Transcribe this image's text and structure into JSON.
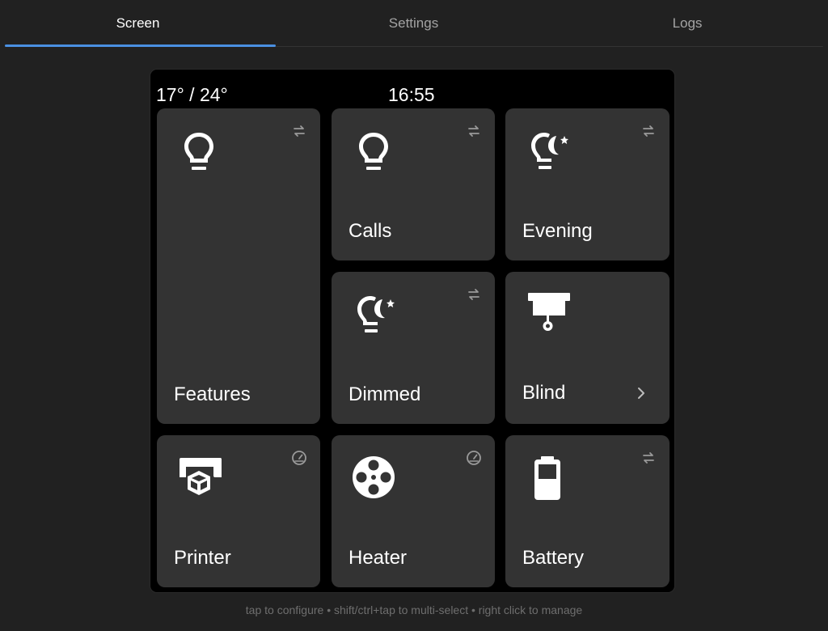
{
  "tabs": [
    {
      "label": "Screen",
      "active": true
    },
    {
      "label": "Settings",
      "active": false
    },
    {
      "label": "Logs",
      "active": false
    }
  ],
  "accent_color": "#4a90e2",
  "status_bar": {
    "temperature": "17° / 24°",
    "time": "16:55"
  },
  "tiles": [
    {
      "label": "Features",
      "icon": "lightbulb-icon",
      "corner_icon": "swap-arrows-icon"
    },
    {
      "label": "Calls",
      "icon": "lightbulb-icon",
      "corner_icon": "swap-arrows-icon"
    },
    {
      "label": "Evening",
      "icon": "lightbulb-night-icon",
      "corner_icon": "swap-arrows-icon"
    },
    {
      "label": "Dimmed",
      "icon": "lightbulb-night-icon",
      "corner_icon": "swap-arrows-icon"
    },
    {
      "label": "Blind",
      "icon": "roller-blind-icon",
      "corner_icon": "chevron-right-icon"
    },
    {
      "label": "Printer",
      "icon": "3d-printer-icon",
      "corner_icon": "gauge-icon"
    },
    {
      "label": "Heater",
      "icon": "film-reel-icon",
      "corner_icon": "gauge-icon"
    },
    {
      "label": "Battery",
      "icon": "battery-icon",
      "corner_icon": "swap-arrows-icon"
    }
  ],
  "hint": "tap to configure • shift/ctrl+tap to multi-select • right click to manage"
}
